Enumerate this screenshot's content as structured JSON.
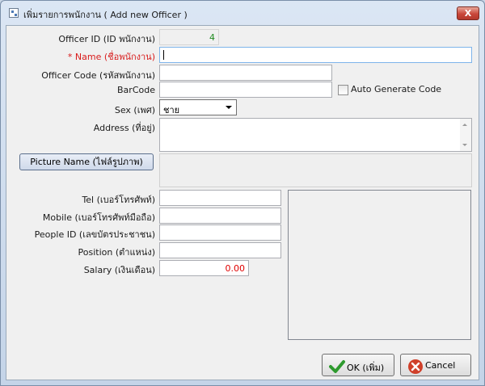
{
  "window": {
    "title": "เพิ่มรายการพนักงาน ( Add new Officer )",
    "close_label": "X"
  },
  "form": {
    "officer_id": {
      "label": "Officer ID (ID พนักงาน)",
      "value": "4"
    },
    "name": {
      "label": "* Name (ชื่อพนักงาน)",
      "value": ""
    },
    "officer_code": {
      "label": "Officer Code (รหัสพนักงาน)",
      "value": ""
    },
    "barcode": {
      "label": "BarCode",
      "value": ""
    },
    "auto_generate": {
      "label": "Auto Generate Code",
      "checked": false
    },
    "sex": {
      "label": "Sex (เพศ)",
      "value": "ชาย"
    },
    "address": {
      "label": "Address (ที่อยู่)",
      "value": ""
    },
    "picture_button": {
      "label": "Picture Name (ไฟล์รูปภาพ)"
    },
    "tel": {
      "label": "Tel (เบอร์โทรศัพท์)",
      "value": ""
    },
    "mobile": {
      "label": "Mobile (เบอร์โทรศัพท์มือถือ)",
      "value": ""
    },
    "people_id": {
      "label": "People ID (เลขบัตรประชาชน)",
      "value": ""
    },
    "position": {
      "label": "Position (ตำแหน่ง)",
      "value": ""
    },
    "salary": {
      "label": "Salary (เงินเดือน)",
      "value": "0.00"
    }
  },
  "buttons": {
    "ok": {
      "label": "OK (เพิ่ม)",
      "icon": "checkmark-icon",
      "color": "#2e9a2e"
    },
    "cancel": {
      "label": "Cancel",
      "icon": "cancel-icon",
      "color": "#d0402a"
    }
  }
}
